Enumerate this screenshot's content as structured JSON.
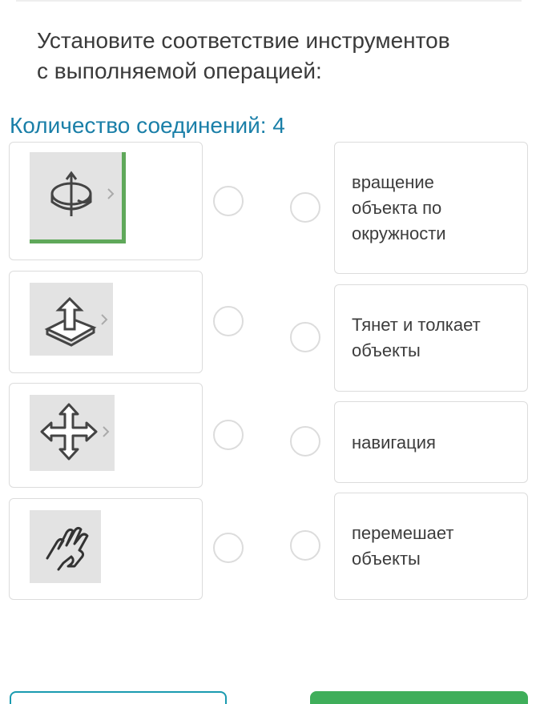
{
  "question": {
    "line1": "Установите соответствие инструментов",
    "line2": "с выполняемой операцией:"
  },
  "connections": {
    "label": "Количество соединений: 4"
  },
  "left_items": [
    {
      "icon": "orbit-tool-icon"
    },
    {
      "icon": "push-pull-tool-icon"
    },
    {
      "icon": "move-tool-icon"
    },
    {
      "icon": "pan-hand-tool-icon"
    }
  ],
  "right_items": [
    {
      "lines": [
        "вращение",
        "объекта по",
        "окружности"
      ]
    },
    {
      "lines": [
        "Тянет и толкает",
        "объекты"
      ]
    },
    {
      "lines": [
        "навигация"
      ]
    },
    {
      "lines": [
        "перемешает",
        "объекты"
      ]
    }
  ],
  "colors": {
    "accent": "#1a7fa8",
    "selected_border": "#5fa85a",
    "next_button": "#3fae5a"
  }
}
